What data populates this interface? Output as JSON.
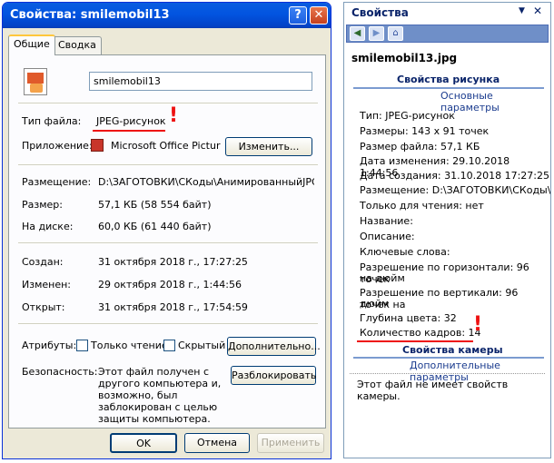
{
  "dialog": {
    "title": "Свойства: smilemobil13",
    "tabs": [
      "Общие",
      "Сводка"
    ],
    "filename": "smilemobil13",
    "file_type_label": "Тип файла:",
    "file_type_value": "JPEG-рисунок",
    "app_label": "Приложение:",
    "app_value": "Microsoft Office Pictur",
    "change_button": "Изменить...",
    "location_label": "Размещение:",
    "location_value": "D:\\ЗАГОТОВКИ\\СКоды\\АнимированныйJPG",
    "size_label": "Размер:",
    "size_value": "57,1 КБ (58 554 байт)",
    "disk_label": "На диске:",
    "disk_value": "60,0 КБ (61 440 байт)",
    "created_label": "Создан:",
    "created_value": "31 октября 2018 г., 17:27:25",
    "modified_label": "Изменен:",
    "modified_value": "29 октября 2018 г., 1:44:56",
    "opened_label": "Открыт:",
    "opened_value": "31 октября 2018 г., 17:54:59",
    "attrs_label": "Атрибуты:",
    "readonly_label": "Только чтение",
    "hidden_label": "Скрытый",
    "advanced_button": "Дополнительно...",
    "security_label": "Безопасность:",
    "security_text": [
      "Этот файл получен с",
      "другого компьютера и,",
      "возможно, был",
      "заблокирован с целью",
      "защиты компьютера."
    ],
    "unblock_button": "Разблокировать",
    "ok": "OK",
    "cancel": "Отмена",
    "apply": "Применить",
    "mark": "!"
  },
  "pane": {
    "title": "Свойства",
    "filename": "smilemobil13.jpg",
    "section_image": "Свойства рисунка",
    "link_basic": "Основные параметры",
    "props": [
      "Тип: JPEG-рисунок",
      "Размеры: 143 x 91 точек",
      "Размер файла: 57,1 КБ",
      "Дата изменения: 29.10.2018 1:44:56",
      "Дата создания: 31.10.2018 17:27:25",
      "Размещение:   D:\\ЗАГОТОВКИ\\СКоды\\",
      "Только для чтения: нет",
      "Название:",
      "Описание:",
      "Ключевые слова:",
      "Разрешение по горизонтали: 96 точек",
      "на дюйм",
      "Разрешение по вертикали: 96 точек на",
      "дюйм",
      "Глубина цвета: 32",
      "Количество кадров: 14"
    ],
    "section_camera": "Свойства камеры",
    "link_advanced": "Дополнительные параметры",
    "no_camera": "Этот файл не имеет свойств камеры.",
    "mark": "!"
  }
}
